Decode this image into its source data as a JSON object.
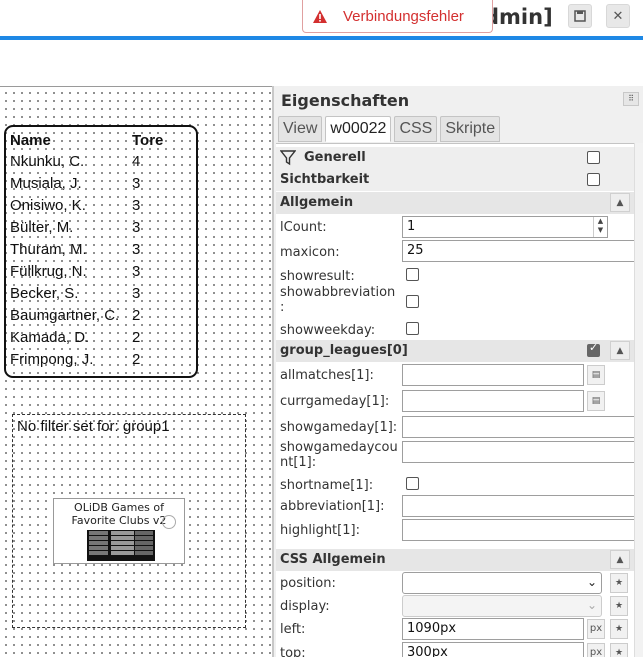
{
  "header": {
    "title_fragment": "dmin]",
    "toast_message": "Verbindungsfehler",
    "buttons": [
      "save-icon",
      "close-icon"
    ]
  },
  "workspace": {
    "table": {
      "headers": [
        "Name",
        "Tore"
      ],
      "rows": [
        [
          "Nkunku, C.",
          "4"
        ],
        [
          "Musiala, J.",
          "3"
        ],
        [
          "Onisiwo, K.",
          "3"
        ],
        [
          "Bülter, M.",
          "3"
        ],
        [
          "Thuram, M.",
          "3"
        ],
        [
          "Füllkrug, N.",
          "3"
        ],
        [
          "Becker, S.",
          "3"
        ],
        [
          "Baumgartner, C.",
          "2"
        ],
        [
          "Kamada, D.",
          "2"
        ],
        [
          "Frimpong, J.",
          "2"
        ]
      ]
    },
    "filter_text": "No filter set for: group1",
    "widget_card_title": "OLiDB Games of Favorite Clubs v2"
  },
  "props": {
    "title": "Eigenschaften",
    "tabs": [
      "View",
      "w00022",
      "CSS",
      "Skripte"
    ],
    "active_tab": "w00022",
    "sections": {
      "generell": "Generell",
      "sichtbarkeit": "Sichtbarkeit",
      "allgemein": "Allgemein",
      "group_leagues": "group_leagues[0]",
      "css_allgemein": "CSS Allgemein"
    },
    "fields": {
      "lcount": {
        "label": "lCount:",
        "value": "1"
      },
      "maxicon": {
        "label": "maxicon:",
        "value": "25"
      },
      "showresult": {
        "label": "showresult:"
      },
      "showabbreviation": {
        "label": "showabbreviation\n:"
      },
      "showweekday": {
        "label": "showweekday:"
      },
      "allmatches": {
        "label": "allmatches[1]:",
        "value": ""
      },
      "currgameday": {
        "label": "currgameday[1]:",
        "value": ""
      },
      "showgameday": {
        "label": "showgameday[1]:",
        "value": ""
      },
      "showgamedaycount": {
        "label": "showgamedaycou\nnt[1]:",
        "value": ""
      },
      "shortname": {
        "label": "shortname[1]:"
      },
      "abbreviation": {
        "label": "abbreviation[1]:",
        "value": ""
      },
      "highlight": {
        "label": "highlight[1]:",
        "value": ""
      },
      "position": {
        "label": "position:",
        "value": ""
      },
      "display": {
        "label": "display:",
        "value": ""
      },
      "left": {
        "label": "left:",
        "value": "1090px",
        "unit": "px"
      },
      "top": {
        "label": "top:",
        "value": "300px",
        "unit": "px"
      }
    }
  }
}
